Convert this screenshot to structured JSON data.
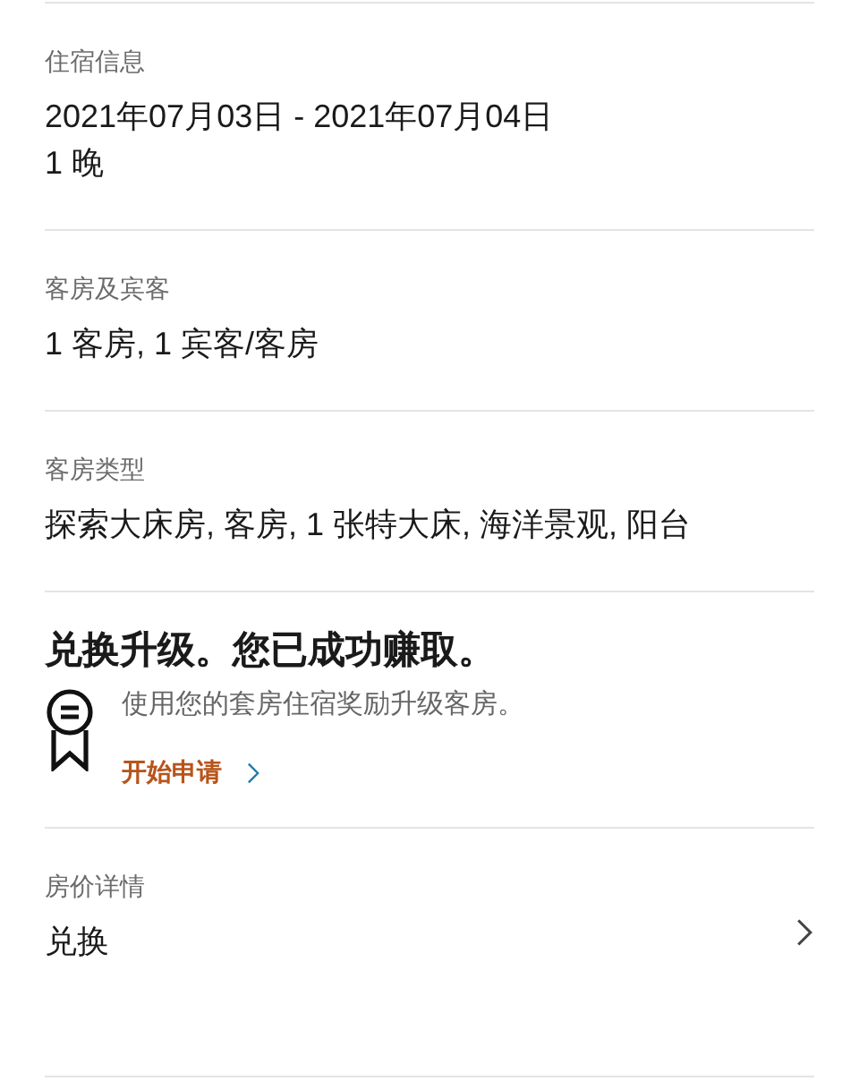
{
  "sections": [
    {
      "label": "住宿信息",
      "values": [
        "2021年07月03日 - 2021年07月04日",
        "1 晚"
      ]
    },
    {
      "label": "客房及宾客",
      "values": [
        "1 客房, 1 宾客/客房"
      ]
    },
    {
      "label": "客房类型",
      "values": [
        "探索大床房, 客房, 1 张特大床, 海洋景观, 阳台"
      ]
    }
  ],
  "upgrade": {
    "title": "兑换升级。您已成功赚取。",
    "description": "使用您的套房住宿奖励升级客房。",
    "link": "开始申请"
  },
  "price": {
    "label": "房价详情",
    "value": "兑换"
  }
}
